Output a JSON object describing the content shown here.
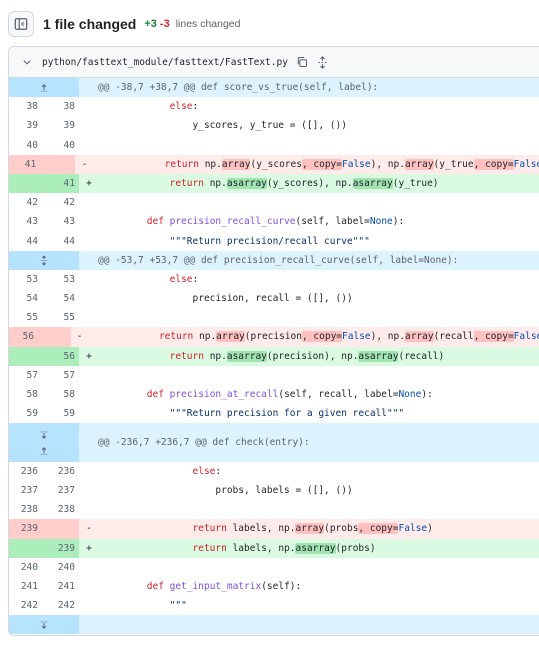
{
  "summary": {
    "title": "1 file changed",
    "additions": "+3",
    "deletions": "-3",
    "label": "lines changed"
  },
  "file": {
    "path": "python/fasttext_module/fasttext/FastText.py"
  },
  "hunks": [
    "@@ -38,7 +38,7 @@ def score_vs_true(self, label):",
    "@@ -53,7 +53,7 @@ def precision_recall_curve(self, label=None):",
    "@@ -236,7 +236,7 @@ def check(entry):"
  ],
  "lines": [
    {
      "old": "38",
      "new": "38",
      "text": "            else:"
    },
    {
      "old": "39",
      "new": "39",
      "text": "                y_scores, y_true = ([], ())"
    },
    {
      "old": "40",
      "new": "40",
      "text": ""
    },
    {
      "old": "41",
      "new": "",
      "marker": "-",
      "text": "            return np.array(y_scores, copy=False), np.array(y_true, copy=False)"
    },
    {
      "old": "",
      "new": "41",
      "marker": "+",
      "text": "            return np.asarray(y_scores), np.asarray(y_true)"
    },
    {
      "old": "42",
      "new": "42",
      "text": ""
    },
    {
      "old": "43",
      "new": "43",
      "text": "        def precision_recall_curve(self, label=None):"
    },
    {
      "old": "44",
      "new": "44",
      "text": "            \"\"\"Return precision/recall curve\"\"\""
    },
    {
      "old": "53",
      "new": "53",
      "text": "            else:"
    },
    {
      "old": "54",
      "new": "54",
      "text": "                precision, recall = ([], ())"
    },
    {
      "old": "55",
      "new": "55",
      "text": ""
    },
    {
      "old": "56",
      "new": "",
      "marker": "-",
      "text": "            return np.array(precision, copy=False), np.array(recall, copy=False)"
    },
    {
      "old": "",
      "new": "56",
      "marker": "+",
      "text": "            return np.asarray(precision), np.asarray(recall)"
    },
    {
      "old": "57",
      "new": "57",
      "text": ""
    },
    {
      "old": "58",
      "new": "58",
      "text": "        def precision_at_recall(self, recall, label=None):"
    },
    {
      "old": "59",
      "new": "59",
      "text": "            \"\"\"Return precision for a given recall\"\"\""
    },
    {
      "old": "236",
      "new": "236",
      "text": "                else:"
    },
    {
      "old": "237",
      "new": "237",
      "text": "                    probs, labels = ([], ())"
    },
    {
      "old": "238",
      "new": "238",
      "text": ""
    },
    {
      "old": "239",
      "new": "",
      "marker": "-",
      "text": "                return labels, np.array(probs, copy=False)"
    },
    {
      "old": "",
      "new": "239",
      "marker": "+",
      "text": "                return labels, np.asarray(probs)"
    },
    {
      "old": "240",
      "new": "240",
      "text": ""
    },
    {
      "old": "241",
      "new": "241",
      "text": "        def get_input_matrix(self):"
    },
    {
      "old": "242",
      "new": "242",
      "text": "            \"\"\""
    }
  ],
  "colors": {
    "addition": "#1a7f37",
    "deletion": "#d1242f",
    "hunk_bg": "#ddf4ff"
  },
  "icons": [
    "sidebar-toggle-icon",
    "chevron-down-icon",
    "copy-icon",
    "unfold-icon",
    "expand-up-icon",
    "expand-down-icon"
  ]
}
